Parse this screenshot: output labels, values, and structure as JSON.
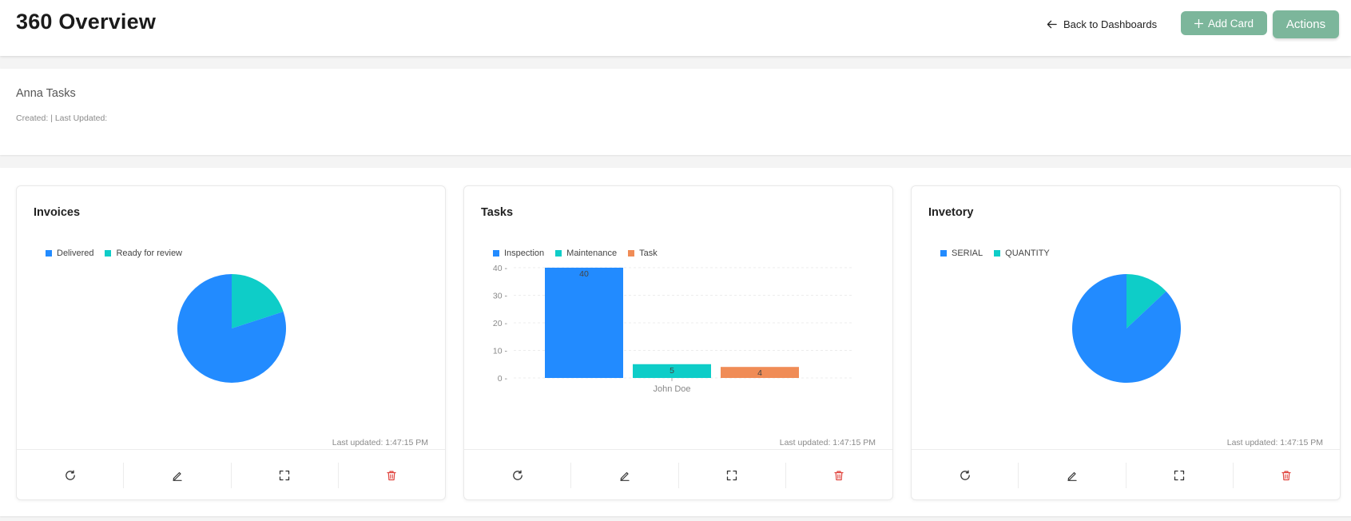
{
  "header": {
    "title": "360 Overview",
    "back_label": "Back to Dashboards",
    "add_card_label": "Add Card",
    "actions_label": "Actions"
  },
  "dashboard": {
    "name": "Anna Tasks",
    "meta": "Created: | Last Updated:"
  },
  "colors": {
    "accent": "#7cb69b",
    "blue": "#228bff",
    "teal": "#0ecdc8",
    "orange": "#f08c56",
    "delete": "#e0443e"
  },
  "footer_icons": [
    "refresh-icon",
    "edit-icon",
    "expand-icon",
    "trash-icon"
  ],
  "cards": [
    {
      "title": "Invoices",
      "updated": "Last updated: 1:47:15 PM",
      "chart_data": {
        "type": "pie",
        "labels": [
          "Delivered",
          "Ready for review"
        ],
        "values": [
          80,
          20
        ],
        "colors": [
          "#228bff",
          "#0ecdc8"
        ],
        "legend": "top-left"
      }
    },
    {
      "title": "Tasks",
      "updated": "Last updated: 1:47:15 PM",
      "chart_data": {
        "type": "bar",
        "categories": [
          "John Doe"
        ],
        "series": [
          {
            "name": "Inspection",
            "values": [
              40
            ],
            "color": "#228bff"
          },
          {
            "name": "Maintenance",
            "values": [
              5
            ],
            "color": "#0ecdc8"
          },
          {
            "name": "Task",
            "values": [
              4
            ],
            "color": "#f08c56"
          }
        ],
        "ylim": [
          0,
          40
        ],
        "yticks": [
          0,
          10,
          20,
          30,
          40
        ],
        "grid": true,
        "legend": "top-left"
      }
    },
    {
      "title": "Invetory",
      "updated": "Last updated: 1:47:15 PM",
      "chart_data": {
        "type": "pie",
        "labels": [
          "SERIAL",
          "QUANTITY"
        ],
        "values": [
          87,
          13
        ],
        "colors": [
          "#228bff",
          "#0ecdc8"
        ],
        "legend": "top-left"
      }
    }
  ]
}
